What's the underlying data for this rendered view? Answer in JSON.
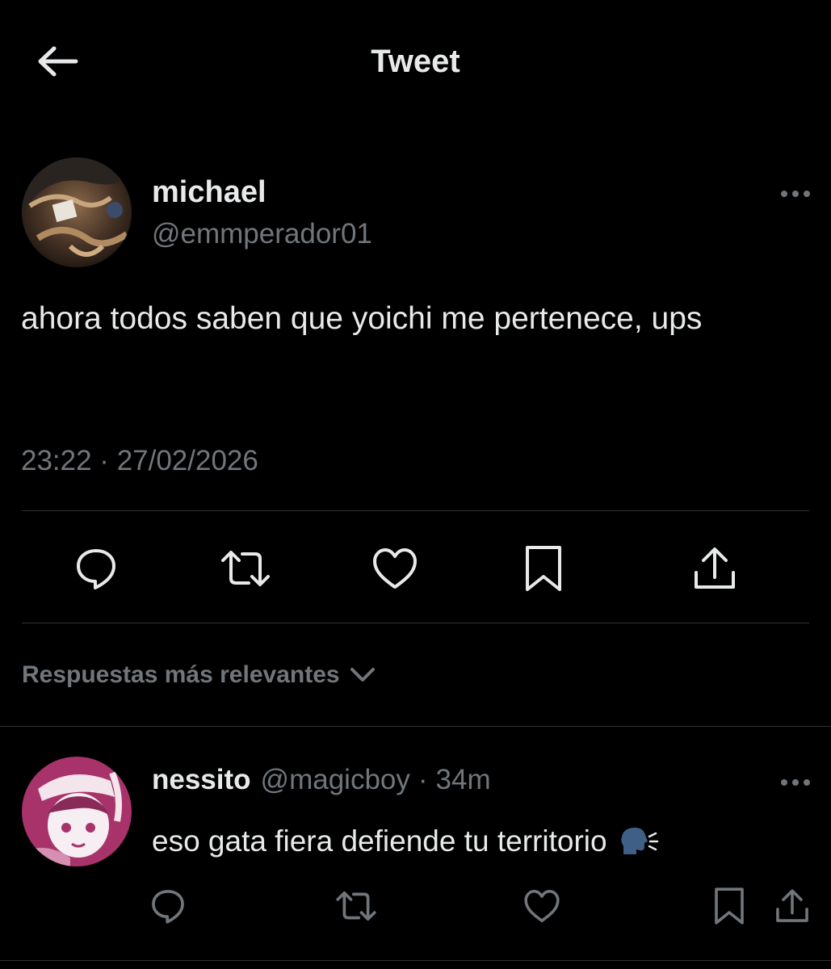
{
  "header": {
    "title": "Tweet",
    "back_icon": "arrow-left-icon"
  },
  "tweet": {
    "author": {
      "name": "michael",
      "handle": "@emmperador01",
      "avatar": "profile-avatar"
    },
    "text": "ahora todos saben que yoichi me pertenece, ups",
    "timestamp": "23:22 · 27/02/2026",
    "more_icon": "more-horizontal-icon",
    "actions": [
      {
        "name": "reply",
        "icon": "reply-icon"
      },
      {
        "name": "retweet",
        "icon": "retweet-icon"
      },
      {
        "name": "like",
        "icon": "heart-icon"
      },
      {
        "name": "bookmark",
        "icon": "bookmark-icon"
      },
      {
        "name": "share",
        "icon": "share-icon"
      }
    ]
  },
  "replies_sort": {
    "label": "Respuestas más relevantes",
    "icon": "chevron-down-icon"
  },
  "replies": [
    {
      "name": "nessito",
      "handle": "@magicboy",
      "separator": "·",
      "time": "34m",
      "text": "eso gata fiera defiende tu territorio",
      "emoji": "speaking-head-icon",
      "actions": [
        "reply-icon",
        "retweet-icon",
        "heart-icon",
        "bookmark-icon",
        "share-icon"
      ]
    }
  ],
  "colors": {
    "background": "#000000",
    "text_primary": "#e7e9ea",
    "text_secondary": "#71767b",
    "divider": "#2f3336",
    "reply_avatar_accent": "#a8336a"
  }
}
